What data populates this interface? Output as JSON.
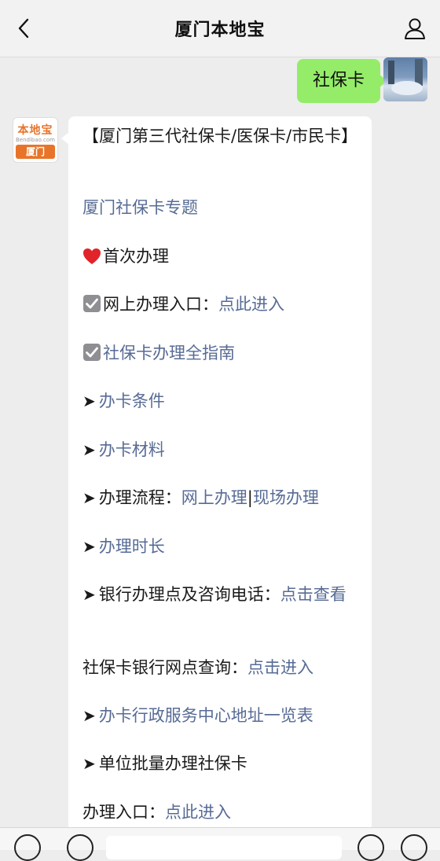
{
  "header": {
    "title": "厦门本地宝"
  },
  "outgoing": {
    "text": "社保卡"
  },
  "bot_avatar": {
    "logo": "本地宝",
    "site": "Bendibao.com",
    "city": "厦门"
  },
  "incoming": {
    "title": "【厦门第三代社保卡/医保卡/市民卡】",
    "topic_link": "厦门社保卡专题",
    "first_time": "首次办理",
    "online_entry_label": "网上办理入口：",
    "online_entry_link": "点此进入",
    "guide_label": "社保卡办理全指南",
    "conditions": "办卡条件",
    "materials": "办卡材料",
    "process_label": "办理流程：",
    "process_online": "网上办理",
    "process_separator": "|",
    "process_onsite": "现场办理",
    "duration": "办理时长",
    "bank_label": "银行办理点及咨询电话：",
    "bank_link": "点击查看",
    "bank_query_label": "社保卡银行网点查询：",
    "bank_query_link": "点击进入",
    "center_link": "办卡行政服务中心地址一览表",
    "batch_label": "单位批量办理社保卡",
    "entry_label": "办理入口：",
    "entry_link": "点此进入"
  },
  "colors": {
    "link": "#576b95",
    "bubble_out": "#95ec69",
    "background": "#ededed",
    "brand": "#e8742a"
  }
}
